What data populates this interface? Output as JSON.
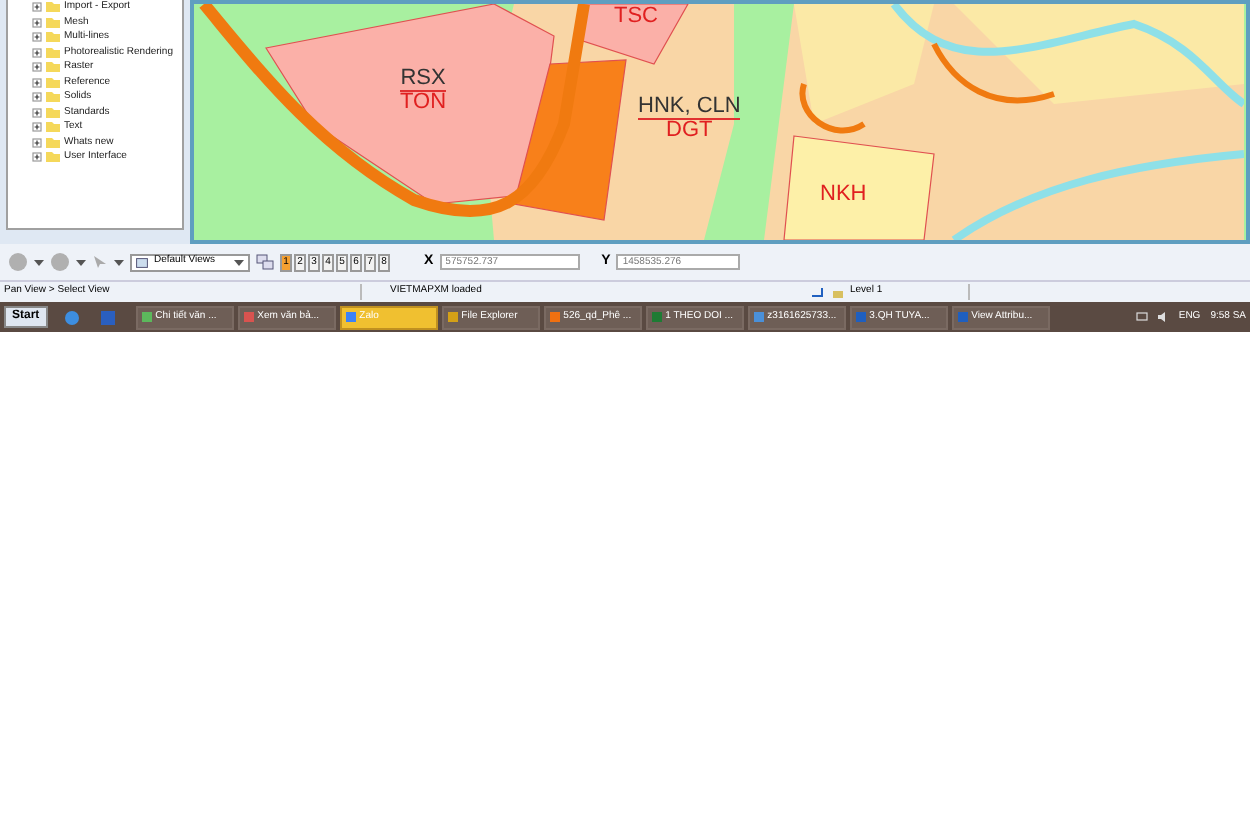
{
  "tree": {
    "items": [
      {
        "label": "Import - Export"
      },
      {
        "label": "Mesh"
      },
      {
        "label": "Multi-lines"
      },
      {
        "label": "Photorealistic Rendering"
      },
      {
        "label": "Raster"
      },
      {
        "label": "Reference"
      },
      {
        "label": "Solids"
      },
      {
        "label": "Standards"
      },
      {
        "label": "Text"
      },
      {
        "label": "Whats new"
      },
      {
        "label": "User Interface"
      }
    ]
  },
  "map": {
    "labels": [
      {
        "top": "RSX",
        "bottom": "TON"
      },
      {
        "top": "HNK, CLN",
        "bottom": "DGT"
      },
      {
        "bottom": "NKH"
      },
      {
        "bottom": "TSC"
      }
    ]
  },
  "toolbar": {
    "views_dropdown": "Default Views",
    "view_buttons": [
      {
        "label": "1",
        "selected": true
      },
      {
        "label": "2",
        "selected": false
      },
      {
        "label": "3",
        "selected": false
      },
      {
        "label": "4",
        "selected": false
      },
      {
        "label": "5",
        "selected": false
      },
      {
        "label": "6",
        "selected": false
      },
      {
        "label": "7",
        "selected": false
      },
      {
        "label": "8",
        "selected": false
      }
    ],
    "x_label": "X",
    "x_value": "575752.737",
    "y_label": "Y",
    "y_value": "1458535.276"
  },
  "status_bar": {
    "prompt": "Pan View > Select View",
    "message": "VIETMAPXM loaded",
    "level": "Level 1"
  },
  "taskbar": {
    "start": "Start",
    "tasks": [
      {
        "label": "Chi tiết văn ...",
        "selected": false
      },
      {
        "label": "Xem văn bả...",
        "selected": false
      },
      {
        "label": "Zalo",
        "selected": true
      },
      {
        "label": "File Explorer",
        "selected": false
      },
      {
        "label": "526_qd_Phê ...",
        "selected": false
      },
      {
        "label": "1 THEO DOI ...",
        "selected": false
      },
      {
        "label": "z3161625733...",
        "selected": false
      },
      {
        "label": "3.QH TUYA...",
        "selected": false
      },
      {
        "label": "View Attribu...",
        "selected": false
      }
    ],
    "language": "ENG",
    "clock": "9:58 SA"
  }
}
